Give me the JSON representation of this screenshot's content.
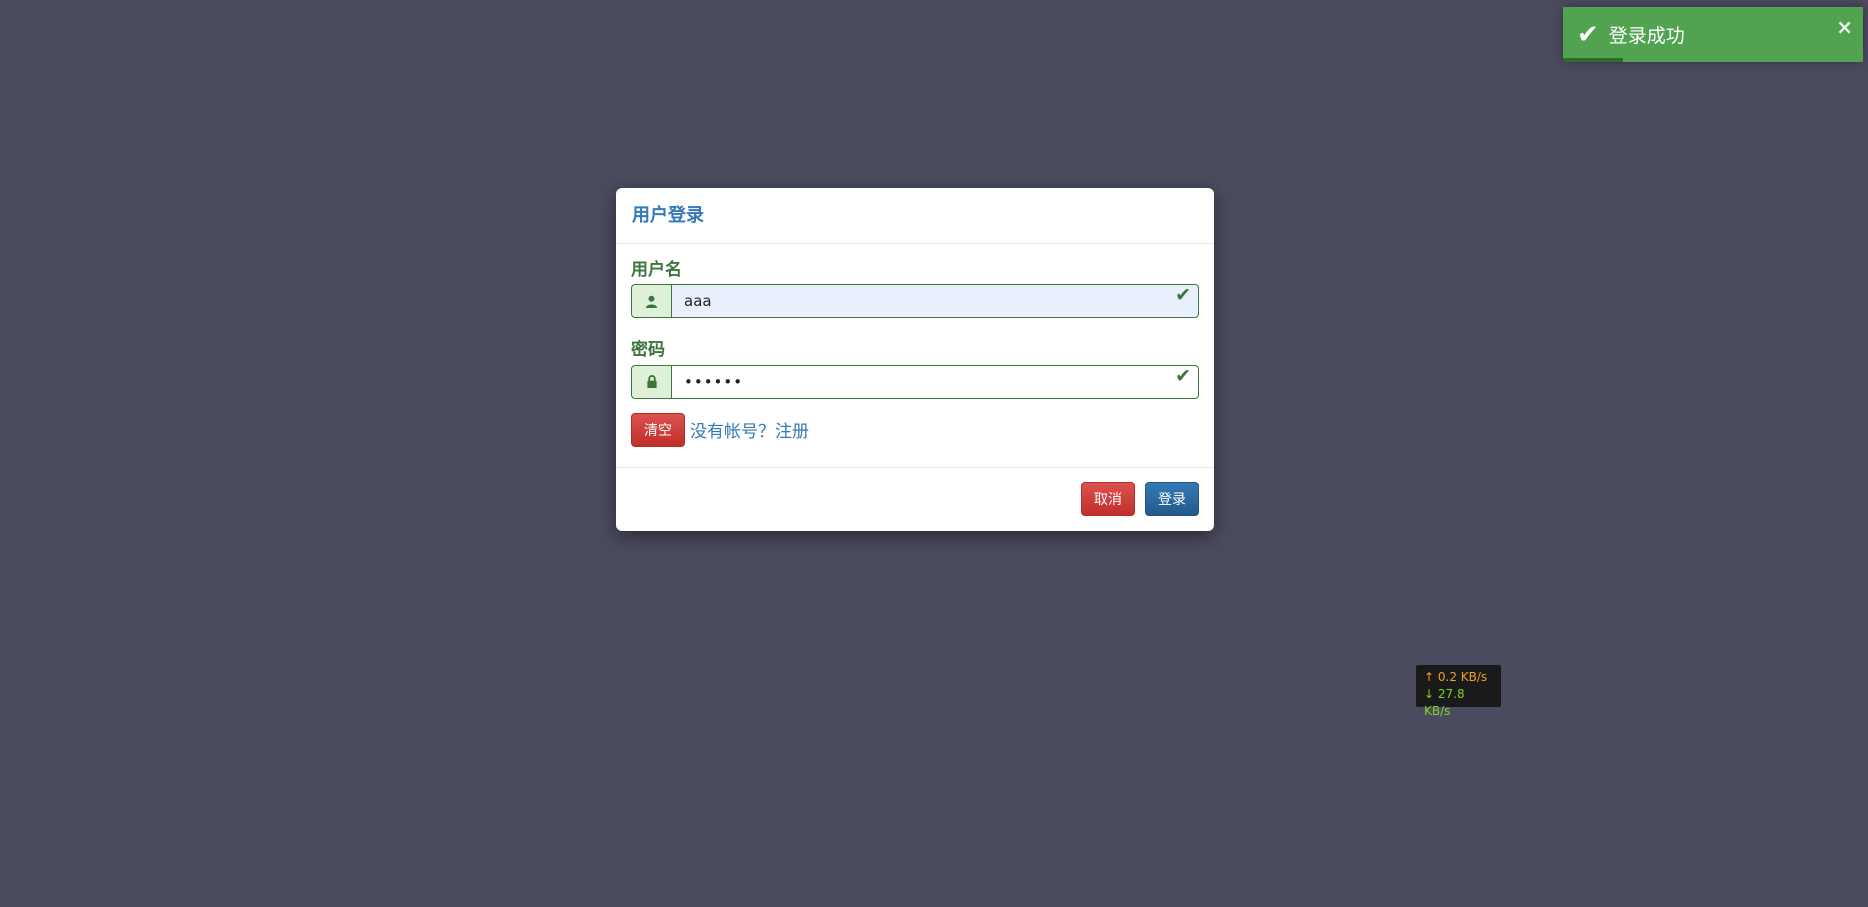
{
  "modal": {
    "title": "用户登录",
    "username": {
      "label": "用户名",
      "value": "aaa",
      "icon": "user-icon",
      "valid": true
    },
    "password": {
      "label": "密码",
      "masked_value": "••••••",
      "icon": "lock-icon",
      "valid": true
    },
    "clear_label": "清空",
    "register_text": "没有帐号？注册",
    "cancel_label": "取消",
    "login_label": "登录"
  },
  "toast": {
    "message": "登录成功",
    "icon": "check-icon",
    "close_glyph": "×",
    "color": "#51a351",
    "progress": 0.2
  },
  "netspeed": {
    "up": "↑ 0.2 KB/s",
    "down": "↓ 27.8 KB/s"
  },
  "colors": {
    "background": "#4b4b5f",
    "success": "#3c763d",
    "primary": "#337ab7",
    "danger": "#d9534f"
  }
}
